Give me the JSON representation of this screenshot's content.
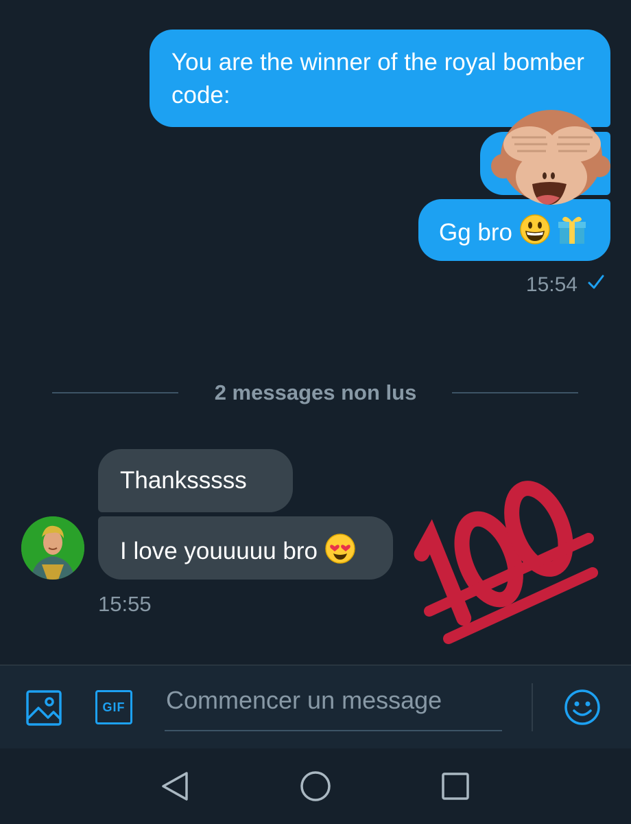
{
  "conversation": {
    "outgoing": [
      {
        "text": "You are the winner of the royal bomber code:"
      },
      {
        "text": "",
        "sticker": "see-no-evil-monkey-emoji"
      },
      {
        "text": "Gg bro",
        "emojis": [
          "grinning-face-emoji",
          "gift-emoji"
        ]
      }
    ],
    "outgoing_time": "15:54",
    "outgoing_status": "sent-checkmark-icon",
    "unread_divider": "2 messages non lus",
    "incoming": [
      {
        "text": "Thanksssss"
      },
      {
        "text": "I love youuuuu bro",
        "emojis": [
          "heart-eyes-emoji"
        ]
      }
    ],
    "incoming_time": "15:55",
    "incoming_reaction": "hundred-points-emoji"
  },
  "composer": {
    "placeholder": "Commencer un message",
    "icons": [
      "image-icon",
      "gif-icon",
      "emoji-icon"
    ],
    "gif_label": "GIF"
  },
  "navigation": {
    "buttons": [
      "back-icon",
      "home-icon",
      "recents-icon"
    ]
  },
  "colors": {
    "background": "#15202b",
    "accent": "#1da1f2",
    "incoming_bubble": "#38444d",
    "secondary_text": "#8899a6",
    "hundred_red": "#c7203c"
  }
}
